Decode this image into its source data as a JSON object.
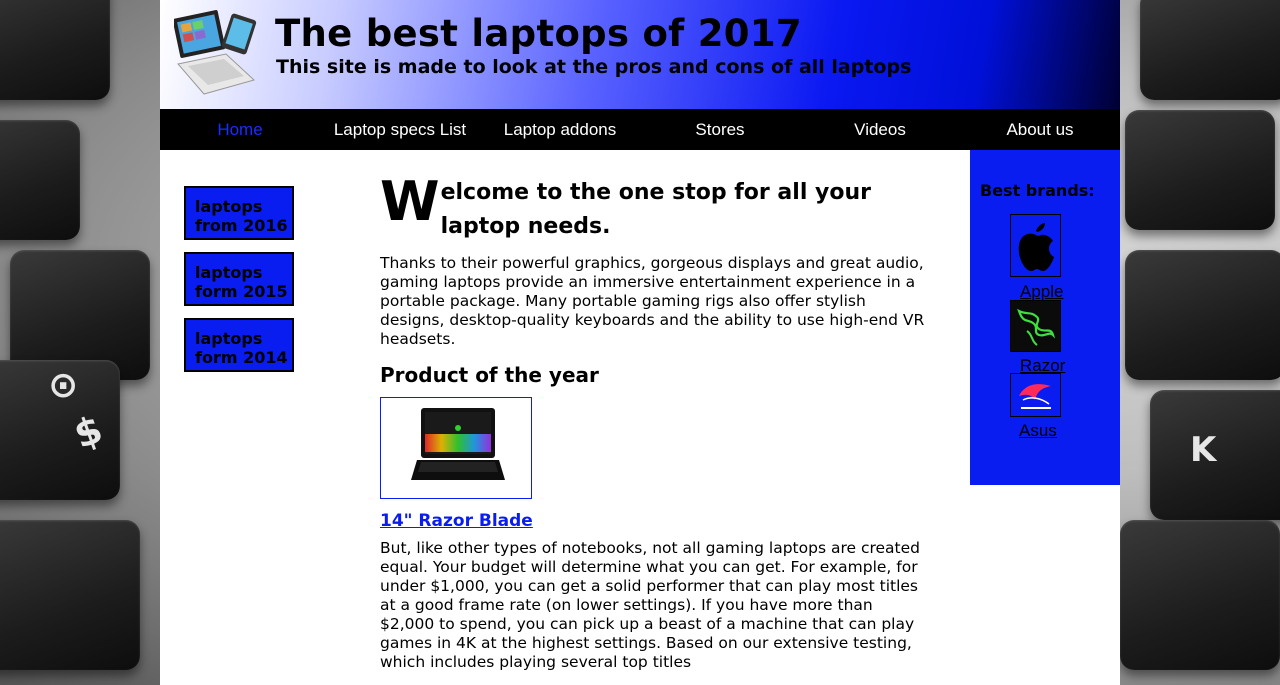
{
  "header": {
    "title": "The best laptops of 2017",
    "subtitle": "This site is made to look at the pros and cons of all laptops",
    "logo_icon": "laptop-tablet-icon"
  },
  "nav": {
    "items": [
      {
        "label": "Home",
        "active": true
      },
      {
        "label": "Laptop specs List",
        "active": false
      },
      {
        "label": "Laptop addons",
        "active": false
      },
      {
        "label": "Stores",
        "active": false
      },
      {
        "label": "Videos",
        "active": false
      },
      {
        "label": "About us",
        "active": false
      }
    ]
  },
  "sidebar_left": {
    "items": [
      {
        "label": "laptops from 2016"
      },
      {
        "label": "laptops form 2015"
      },
      {
        "label": "laptops form 2014"
      }
    ]
  },
  "main": {
    "welcome_cap": "W",
    "welcome_rest": "elcome to the one stop for all your laptop needs.",
    "intro": "Thanks to their powerful graphics, gorgeous displays and great audio, gaming laptops provide an immersive entertainment experience in a portable package. Many portable gaming rigs also offer stylish designs, desktop-quality keyboards and the ability to use high-end VR headsets.",
    "product_heading": "Product of the year",
    "product_link": "14\" Razor Blade",
    "body": "But, like other types of notebooks, not all gaming laptops are created equal. Your budget will determine what you can get. For example, for under $1,000, you can get a solid performer that can play most titles at a good frame rate (on lower settings). If you have more than $2,000 to spend, you can pick up a beast of a machine that can play games in 4K at the highest settings. Based on our extensive testing, which includes playing several top titles"
  },
  "sidebar_right": {
    "title": "Best brands:",
    "brands": [
      {
        "label": "Apple",
        "icon": "apple-logo-icon"
      },
      {
        "label": "Razor",
        "icon": "razer-logo-icon"
      },
      {
        "label": "Asus",
        "icon": "asus-rog-logo-icon"
      }
    ]
  },
  "colors": {
    "accent_blue": "#0a1df0",
    "nav_bg": "#000000",
    "active_nav": "#1a2cff"
  },
  "background": {
    "keyboard_glyphs": [
      "$",
      "K",
      "⊙"
    ]
  }
}
